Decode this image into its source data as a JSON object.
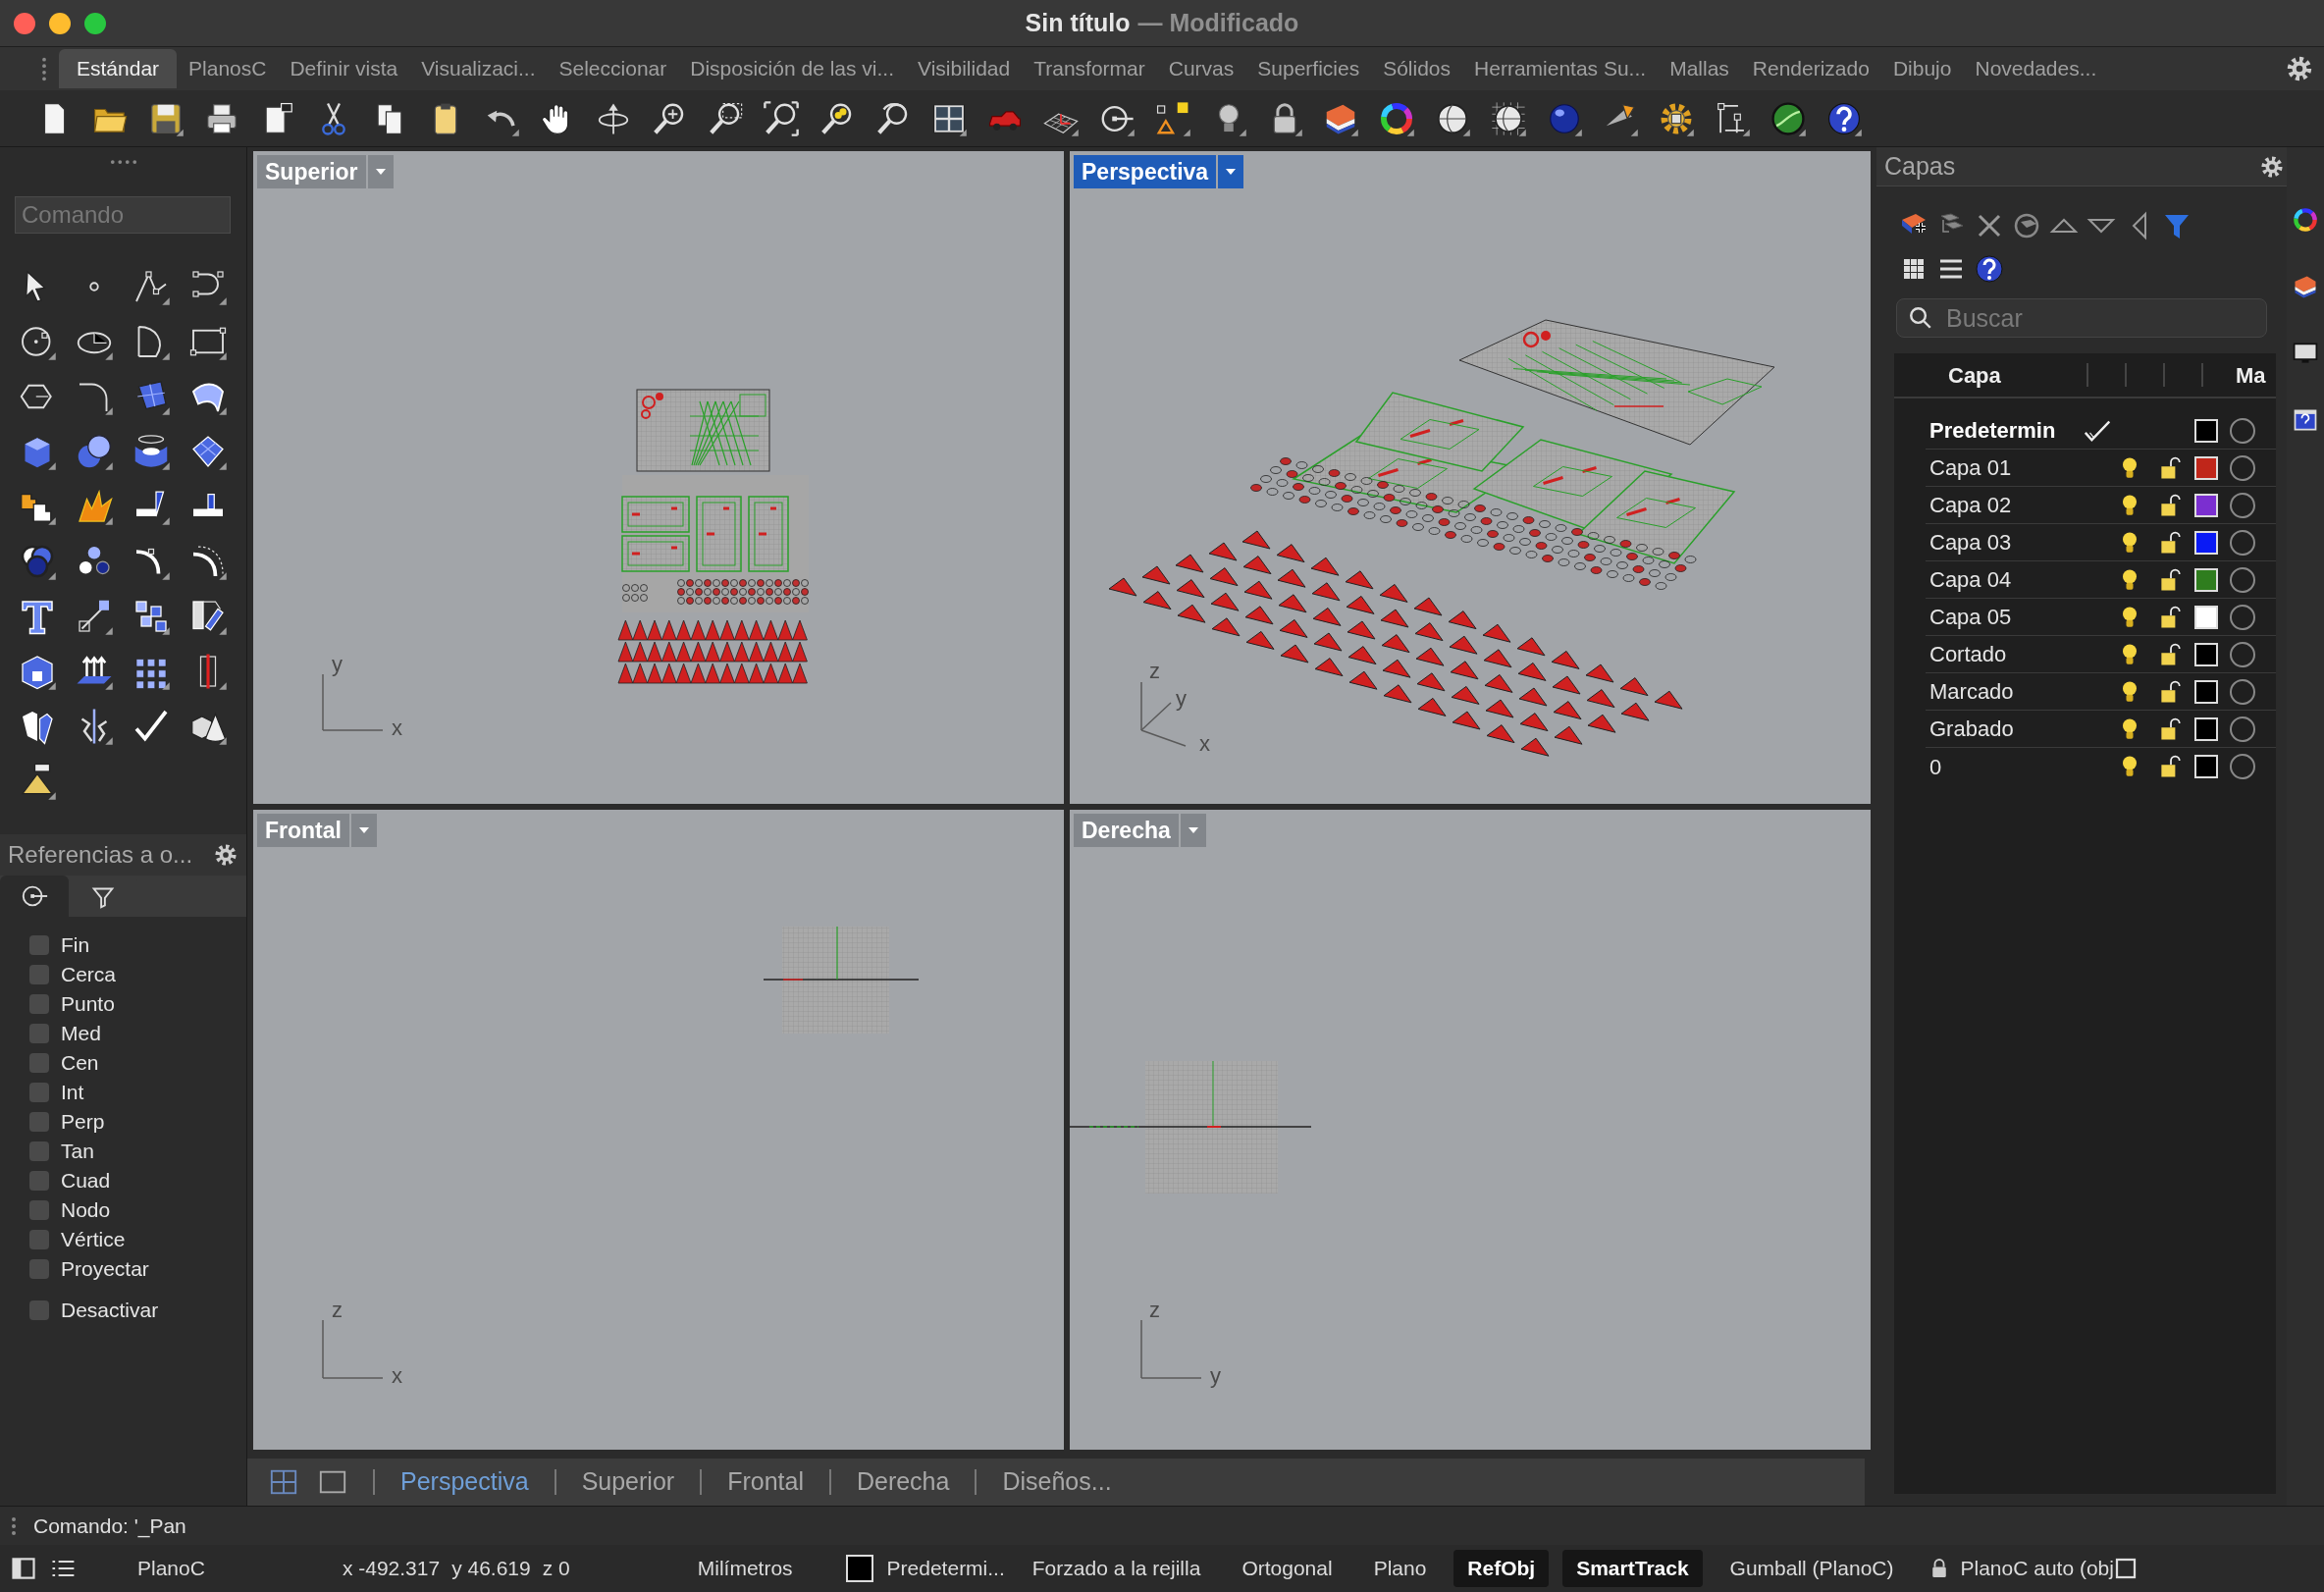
{
  "window": {
    "title": "Sin título",
    "state": "— Modificado"
  },
  "toolbar_tabs": [
    {
      "label": "Estándar",
      "selected": true
    },
    {
      "label": "PlanosC",
      "selected": false
    },
    {
      "label": "Definir vista",
      "selected": false
    },
    {
      "label": "Visualizaci...",
      "selected": false
    },
    {
      "label": "Seleccionar",
      "selected": false
    },
    {
      "label": "Disposición de las vi...",
      "selected": false
    },
    {
      "label": "Visibilidad",
      "selected": false
    },
    {
      "label": "Transformar",
      "selected": false
    },
    {
      "label": "Curvas",
      "selected": false
    },
    {
      "label": "Superficies",
      "selected": false
    },
    {
      "label": "Sólidos",
      "selected": false
    },
    {
      "label": "Herramientas Su...",
      "selected": false
    },
    {
      "label": "Mallas",
      "selected": false
    },
    {
      "label": "Renderizado",
      "selected": false
    },
    {
      "label": "Dibujo",
      "selected": false
    },
    {
      "label": "Novedades...",
      "selected": false
    }
  ],
  "command_field": {
    "placeholder": "Comando"
  },
  "osnap_panel": {
    "title": "Referencias a o...",
    "tabs": [
      {
        "kind": "snap",
        "selected": true
      },
      {
        "kind": "filter",
        "selected": false
      }
    ],
    "snaps": [
      {
        "label": "Fin",
        "checked": false
      },
      {
        "label": "Cerca",
        "checked": false
      },
      {
        "label": "Punto",
        "checked": false
      },
      {
        "label": "Med",
        "checked": false
      },
      {
        "label": "Cen",
        "checked": false
      },
      {
        "label": "Int",
        "checked": false
      },
      {
        "label": "Perp",
        "checked": false
      },
      {
        "label": "Tan",
        "checked": false
      },
      {
        "label": "Cuad",
        "checked": false
      },
      {
        "label": "Nodo",
        "checked": false
      },
      {
        "label": "Vértice",
        "checked": false
      },
      {
        "label": "Proyectar",
        "checked": false
      }
    ],
    "disable": {
      "label": "Desactivar",
      "checked": false
    }
  },
  "viewports": [
    {
      "title": "Superior",
      "kind": "top",
      "selected": false,
      "axes": [
        "y",
        "x"
      ]
    },
    {
      "title": "Perspectiva",
      "kind": "perspective",
      "selected": true,
      "axes": [
        "z",
        "y",
        "x"
      ]
    },
    {
      "title": "Frontal",
      "kind": "front",
      "selected": false,
      "axes": [
        "z",
        "x"
      ]
    },
    {
      "title": "Derecha",
      "kind": "right",
      "selected": false,
      "axes": [
        "z",
        "y"
      ]
    }
  ],
  "viewport_tabs": [
    {
      "label": "Perspectiva",
      "selected": true
    },
    {
      "label": "Superior",
      "selected": false
    },
    {
      "label": "Frontal",
      "selected": false
    },
    {
      "label": "Derecha",
      "selected": false
    },
    {
      "label": "Diseños...",
      "selected": false
    }
  ],
  "layers_panel": {
    "title": "Capas",
    "search": {
      "placeholder": "Buscar"
    },
    "columns": [
      "Capa",
      "Ma"
    ],
    "layers": [
      {
        "name": "Predetermin",
        "current": true,
        "color": "#000000"
      },
      {
        "name": "Capa 01",
        "current": false,
        "color": "#c0261a"
      },
      {
        "name": "Capa 02",
        "current": false,
        "color": "#7b2fd0"
      },
      {
        "name": "Capa 03",
        "current": false,
        "color": "#0a1af5"
      },
      {
        "name": "Capa 04",
        "current": false,
        "color": "#2f7d1e"
      },
      {
        "name": "Capa 05",
        "current": false,
        "color": "#ffffff"
      },
      {
        "name": "Cortado",
        "current": false,
        "color": "#000000"
      },
      {
        "name": "Marcado",
        "current": false,
        "color": "#000000"
      },
      {
        "name": "Grabado",
        "current": false,
        "color": "#000000"
      },
      {
        "name": "0",
        "current": false,
        "color": "#000000"
      }
    ]
  },
  "command_line": "Comando: '_Pan",
  "status_bar": {
    "cplane": "PlanoC",
    "x": "x -492.317",
    "y": "y 46.619",
    "z": "z 0",
    "units": "Milímetros",
    "layer": {
      "name": "Predetermi...",
      "color": "#000000"
    },
    "toggles": [
      {
        "label": "Forzado a la rejilla",
        "on": false
      },
      {
        "label": "Ortogonal",
        "on": false
      },
      {
        "label": "Plano",
        "on": false
      },
      {
        "label": "RefObj",
        "on": true
      },
      {
        "label": "SmartTrack",
        "on": true
      },
      {
        "label": "Gumball (PlanoC)",
        "on": false
      }
    ],
    "filter": "PlanoC auto (obj"
  }
}
